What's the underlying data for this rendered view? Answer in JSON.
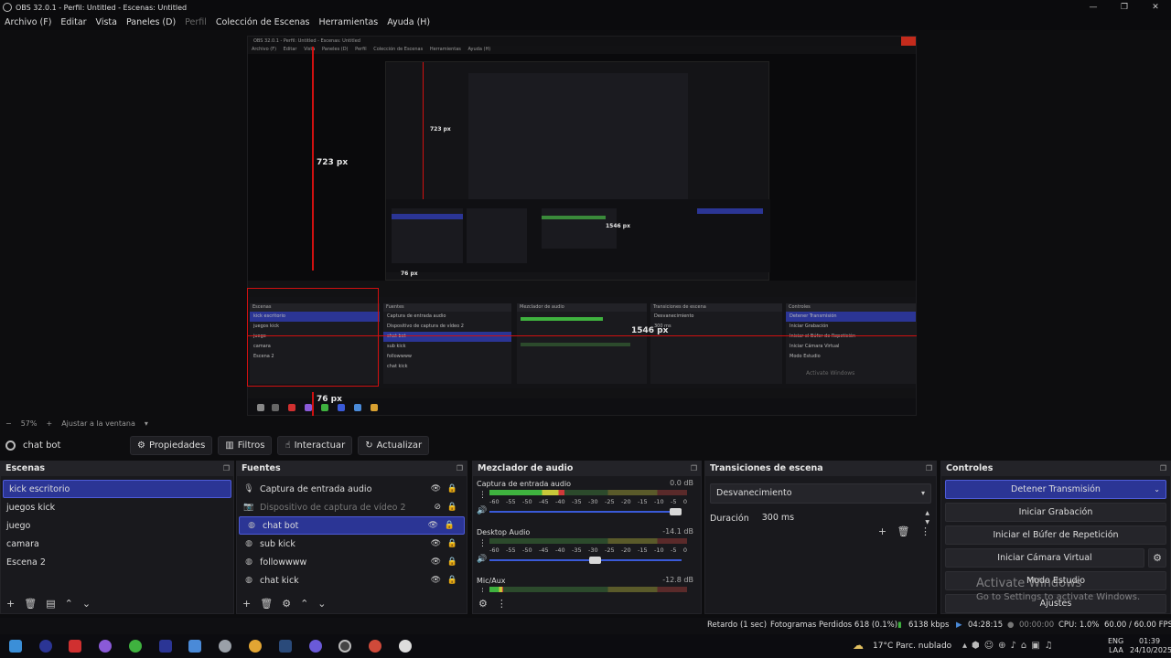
{
  "window": {
    "title": "OBS 32.0.1 - Perfil: Untitled - Escenas: Untitled",
    "minimize": "—",
    "maximize": "❐",
    "close": "✕"
  },
  "menu": [
    "Archivo (F)",
    "Editar",
    "Vista",
    "Paneles (D)",
    "Perfil",
    "Colección de Escenas",
    "Herramientas",
    "Ayuda (H)"
  ],
  "preview": {
    "nested_title": "OBS 32.0.1 - Perfil: Untitled - Escenas: Untitled",
    "nested_menu": [
      "Archivo (F)",
      "Editar",
      "Vista",
      "Paneles (D)",
      "Perfil",
      "Colección de Escenas",
      "Herramientas",
      "Ayuda (H)"
    ],
    "measure_723": "723 px",
    "measure_1546": "1546 px",
    "measure_76": "76 px",
    "inner_723": "723 px",
    "inner_1546": "1546 px",
    "inner_76": "76 px",
    "inner_watermark": "Activate Windows"
  },
  "zoom": {
    "minus": "−",
    "value": "57%",
    "plus": "+",
    "fit": "Ajustar a la ventana",
    "chevron": "▾"
  },
  "toolbar": {
    "source_name": "chat bot",
    "properties": "Propiedades",
    "filters": "Filtros",
    "interact": "Interactuar",
    "refresh": "Actualizar"
  },
  "scenes": {
    "title": "Escenas",
    "items": [
      "kick escritorio",
      "juegos kick",
      "juego",
      "camara",
      "Escena 2"
    ],
    "selected": 0
  },
  "sources": {
    "title": "Fuentes",
    "items": [
      {
        "label": "Captura de entrada audio",
        "icon": "microphone-icon",
        "dim": false
      },
      {
        "label": "Dispositivo de captura de vídeo 2",
        "icon": "camera-icon",
        "dim": true
      },
      {
        "label": "chat bot",
        "icon": "globe-icon",
        "dim": false
      },
      {
        "label": "sub kick",
        "icon": "globe-icon",
        "dim": false
      },
      {
        "label": "followwww",
        "icon": "globe-icon",
        "dim": false
      },
      {
        "label": "chat kick",
        "icon": "globe-icon",
        "dim": false
      }
    ],
    "selected": 2
  },
  "mixer": {
    "title": "Mezclador de audio",
    "ticks": [
      "-60",
      "-55",
      "-50",
      "-45",
      "-40",
      "-35",
      "-30",
      "-25",
      "-20",
      "-15",
      "-10",
      "-5",
      "0"
    ],
    "channels": [
      {
        "name": "Captura de entrada audio",
        "db": "0.0 dB",
        "level": 0.38,
        "volume": 1.0
      },
      {
        "name": "Desktop Audio",
        "db": "-14.1 dB",
        "level": 0.0,
        "volume": 0.58
      },
      {
        "name": "Mic/Aux",
        "db": "-12.8 dB",
        "level": 0.07,
        "volume": 1.0
      }
    ]
  },
  "transitions": {
    "title": "Transiciones de escena",
    "selected": "Desvanecimiento",
    "duration_label": "Duración",
    "duration_value": "300 ms"
  },
  "controls": {
    "title": "Controles",
    "stop_stream": "Detener Transmisión",
    "start_recording": "Iniciar Grabación",
    "start_replay": "Iniciar el Búfer de Repetición",
    "start_vcam": "Iniciar Cámara Virtual",
    "studio_mode": "Modo Estudio",
    "settings": "Ajustes"
  },
  "watermark": {
    "line1": "Activate Windows",
    "line2": "Go to Settings to activate Windows."
  },
  "status": {
    "delay": "Retardo (1 sec)",
    "dropped": "Fotogramas Perdidos 618 (0.1%)",
    "bitrate": "6138 kbps",
    "stream_time": "04:28:15",
    "rec_time": "00:00:00",
    "cpu": "CPU: 1.0%",
    "fps": "60.00 / 60.00 FPS"
  },
  "taskbar": {
    "weather": "17°C  Parc. nublado",
    "lang1": "ENG",
    "lang2": "LAA",
    "time": "01:39",
    "date": "24/10/2025"
  },
  "colors": {
    "accent": "#2b3595",
    "record_red": "#d01010",
    "meter_green": "#3fb23f"
  }
}
